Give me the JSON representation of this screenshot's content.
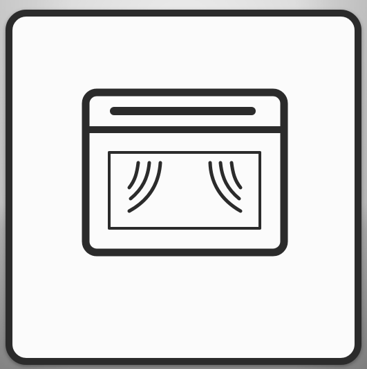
{
  "icon": {
    "name": "oven-icon",
    "stroke_color": "#2b2b2b",
    "tile_background": "#fbfbfb"
  }
}
